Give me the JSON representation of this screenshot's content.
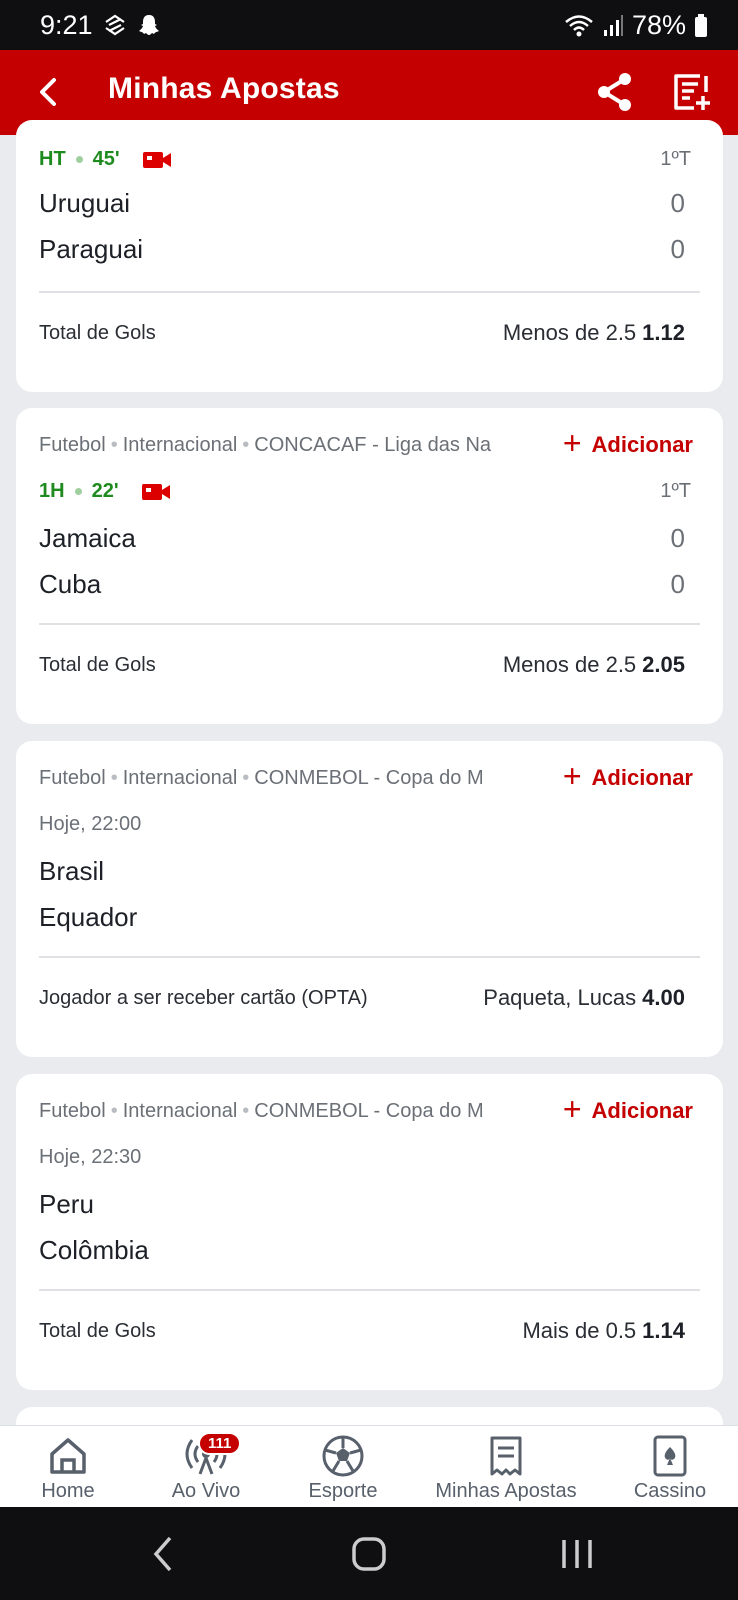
{
  "status_bar": {
    "time": "9:21",
    "battery": "78%"
  },
  "header": {
    "title": "Minhas Apostas"
  },
  "cards": [
    {
      "live_status": "HT",
      "live_minute": "45'",
      "period": "1ºT",
      "home_team": "Uruguai",
      "away_team": "Paraguai",
      "home_score": "0",
      "away_score": "0",
      "market": "Total de Gols",
      "selection": "Menos de 2.5",
      "odds": "1.12"
    },
    {
      "sport": "Futebol",
      "region": "Internacional",
      "league": "CONCACAF - Liga das Na",
      "add_label": "Adicionar",
      "live_status": "1H",
      "live_minute": "22'",
      "period": "1ºT",
      "home_team": "Jamaica",
      "away_team": "Cuba",
      "home_score": "0",
      "away_score": "0",
      "market": "Total de Gols",
      "selection": "Menos de 2.5",
      "odds": "2.05"
    },
    {
      "sport": "Futebol",
      "region": "Internacional",
      "league": "CONMEBOL - Copa do M",
      "add_label": "Adicionar",
      "start_time": "Hoje, 22:00",
      "home_team": "Brasil",
      "away_team": "Equador",
      "market": "Jogador a ser receber cartão (OPTA)",
      "selection": "Paqueta, Lucas",
      "odds": "4.00"
    },
    {
      "sport": "Futebol",
      "region": "Internacional",
      "league": "CONMEBOL - Copa do M",
      "add_label": "Adicionar",
      "start_time": "Hoje, 22:30",
      "home_team": "Peru",
      "away_team": "Colômbia",
      "market": "Total de Gols",
      "selection": "Mais de 0.5",
      "odds": "1.14"
    }
  ],
  "bottom_nav": {
    "items": [
      {
        "label": "Home",
        "icon": "home-icon"
      },
      {
        "label": "Ao Vivo",
        "icon": "live-broadcast-icon",
        "badge": "111"
      },
      {
        "label": "Esporte",
        "icon": "soccer-ball-icon"
      },
      {
        "label": "Minhas Apostas",
        "icon": "receipt-icon"
      },
      {
        "label": "Cassino",
        "icon": "playing-card-icon"
      }
    ]
  },
  "colors": {
    "brand_red": "#c40000",
    "live_green": "#1f8b1f"
  }
}
